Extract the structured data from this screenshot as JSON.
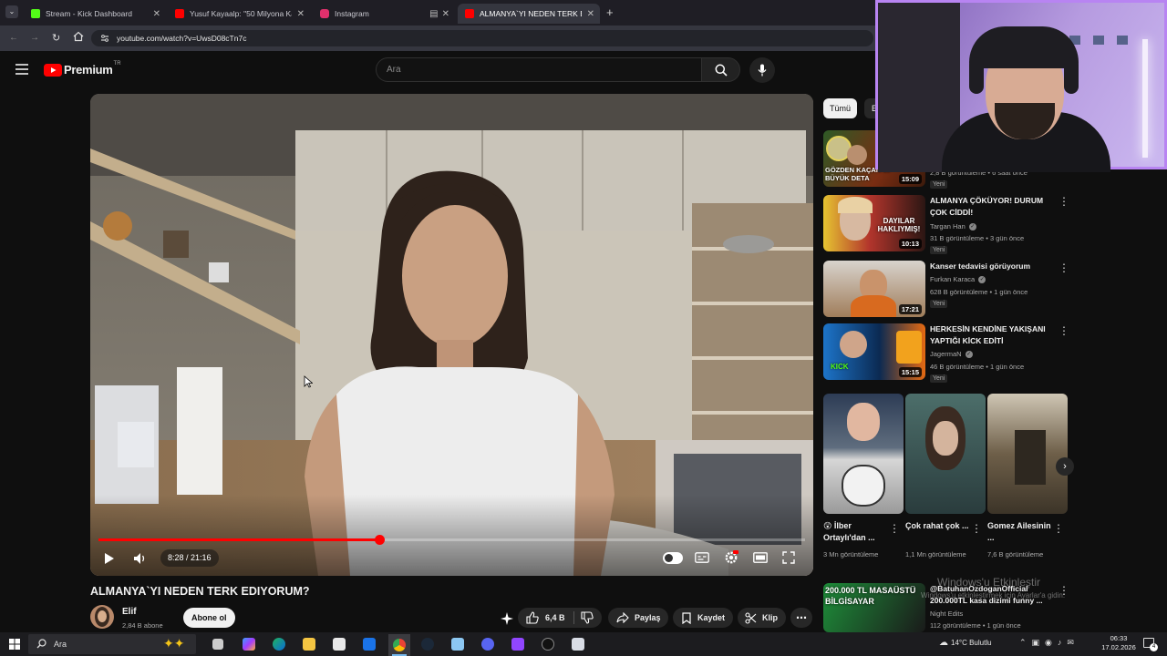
{
  "browser": {
    "tabs": [
      {
        "title": "Stream - Kick Dashboard",
        "color": "#53fc18"
      },
      {
        "title": "Yusuf Kayaalp: \"50 Milyona Kan",
        "color": "#ff0000"
      },
      {
        "title": "Instagram",
        "color": "#e1306c"
      },
      {
        "title": "ALMANYA`YI NEDEN TERK EDIY",
        "color": "#ff0000"
      }
    ],
    "new_tab": "+",
    "url": "youtube.com/watch?v=UwsD08cTn7c"
  },
  "youtube": {
    "logo_text": "Premium",
    "logo_badge": "TR",
    "search_placeholder": "Ara"
  },
  "player": {
    "time": "8:28 / 21:16",
    "progress_fraction": 0.398
  },
  "video": {
    "title": "ALMANYA`YI NEDEN TERK EDIYORUM?",
    "channel": "Elif",
    "subscribers": "2,84 B abone",
    "subscribe_label": "Abone ol",
    "likes": "6,4 B",
    "share_label": "Paylaş",
    "save_label": "Kaydet",
    "clip_label": "Klip"
  },
  "sidebar": {
    "chips": [
      "Tümü",
      "Eli"
    ],
    "recommendations": [
      {
        "title": "",
        "channel": "",
        "meta": "2,8 B görüntüleme • 6 saat önce",
        "badge": "Yeni",
        "duration": "15:09",
        "thumb_text": "GÖZDEN KAÇAN 10 BÜYÜK DETA",
        "thumb_color": "#7a2d12"
      },
      {
        "title": "ALMANYA ÇÖKÜYOR! DURUM ÇOK CİDDİ!",
        "channel": "Targan Han",
        "meta": "31 B görüntüleme • 3 gün önce",
        "badge": "Yeni",
        "duration": "10:13",
        "thumb_text": "DAYILAR HAKLIYMIŞ!",
        "thumb_color": "#8f2a25"
      },
      {
        "title": "Kanser tedavisi görüyorum",
        "channel": "Furkan Karaca",
        "meta": "628 B görüntüleme • 1 gün önce",
        "badge": "Yeni",
        "duration": "17:21",
        "thumb_text": "",
        "thumb_color": "#b58a5d"
      },
      {
        "title": "HERKESİN KENDİNE YAKIŞANI YAPTIĞI KİCK EDİTİ",
        "channel": "JagermaN",
        "meta": "46 B görüntüleme • 1 gün önce",
        "badge": "Yeni",
        "duration": "15:15",
        "thumb_text": "KICK",
        "thumb_color": "#1b4e8c"
      }
    ],
    "shorts": [
      {
        "title": "😲 İlber Ortaylı'dan ...",
        "views": "3 Mn görüntüleme"
      },
      {
        "title": "Çok rahat çok ...",
        "views": "1,1 Mn görüntüleme"
      },
      {
        "title": "Gomez Ailesinin ...",
        "views": "7,6 B görüntüleme"
      }
    ],
    "last_rec": {
      "title": "@BatuhanOzdoganOfficial 200.000TL kasa dizimi funny ...",
      "channel": "Night Edits",
      "meta": "112 görüntüleme • 1 gün önce",
      "thumb_text": "200.000 TL MASAÜSTÜ BİLGİSAYAR"
    }
  },
  "watermark": {
    "line1": "Windows'u Etkinleştir",
    "line2": "Windows'u etkinleştirmek için Ayarlar'a gidin."
  },
  "taskbar": {
    "search_label": "Ara",
    "weather": "14°C Bulutlu",
    "time": "06:33",
    "date": "17.02.2026"
  }
}
